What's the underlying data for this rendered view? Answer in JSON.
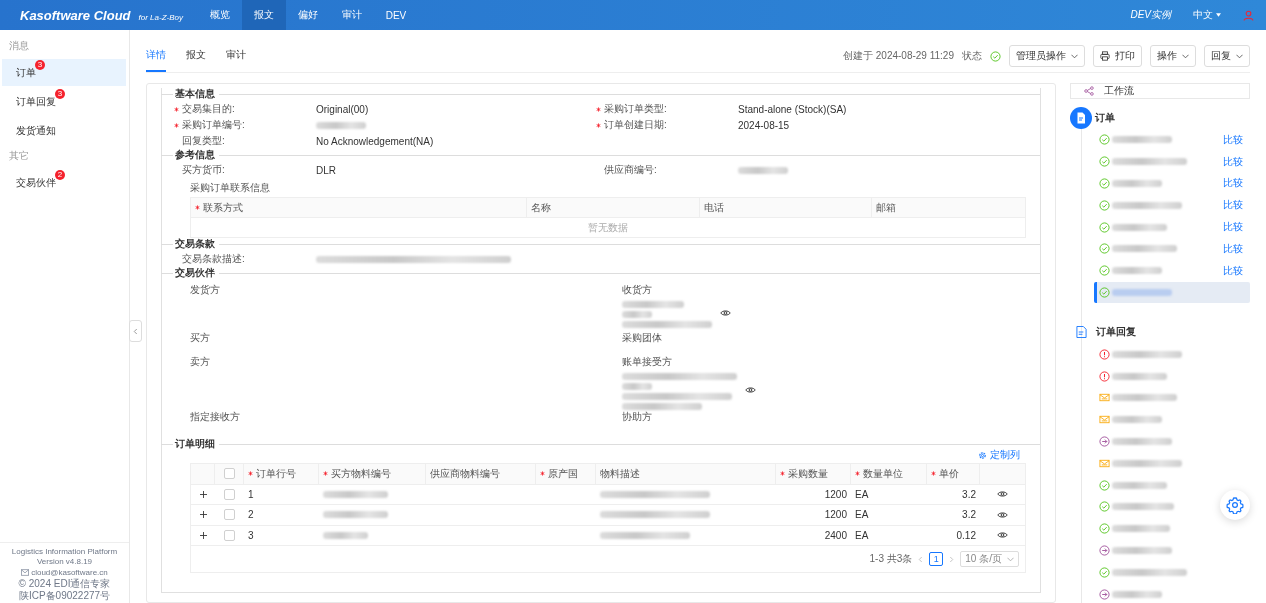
{
  "header": {
    "brand": "Kasoftware Cloud",
    "brand_sub": "for La-Z-Boy",
    "nav": [
      {
        "label": "概览",
        "selected": false
      },
      {
        "label": "报文",
        "selected": true
      },
      {
        "label": "偏好",
        "selected": false
      },
      {
        "label": "审计",
        "selected": false
      },
      {
        "label": "DEV",
        "selected": false
      }
    ],
    "instance": "DEV实例",
    "language": "中文"
  },
  "sidebar": {
    "sections": [
      {
        "title": "消息",
        "items": [
          {
            "label": "订单",
            "badge": "3",
            "selected": true
          },
          {
            "label": "订单回复",
            "badge": "3",
            "selected": false
          },
          {
            "label": "发货通知",
            "selected": false
          }
        ]
      },
      {
        "title": "其它",
        "items": [
          {
            "label": "交易伙伴",
            "badge": "2",
            "selected": false
          }
        ]
      }
    ],
    "footer": [
      "Logistics Information Platform",
      "Version v4.8.19",
      "cloud@kasoftware.cn",
      "© 2024 EDI通信专家",
      "陕ICP备09022277号"
    ]
  },
  "tabs": [
    {
      "label": "详情",
      "selected": true
    },
    {
      "label": "报文",
      "selected": false
    },
    {
      "label": "审计",
      "selected": false
    }
  ],
  "toolbar": {
    "created": "创建于 2024-08-29 11:29",
    "status_label": "状态",
    "status": {
      "kind": "ok"
    },
    "buttons": [
      {
        "label": "管理员操作",
        "kind": "dropdown"
      },
      {
        "label": "打印",
        "kind": "print"
      },
      {
        "label": "操作",
        "kind": "dropdown"
      },
      {
        "label": "回复",
        "kind": "dropdown"
      }
    ]
  },
  "basic_info": {
    "title": "基本信息",
    "fields": [
      {
        "label": "交易集目的:",
        "required": true,
        "value": "Original(00)"
      },
      {
        "label": "采购订单类型:",
        "required": true,
        "value": "Stand-alone (Stock)(SA)"
      },
      {
        "label": "采购订单编号:",
        "required": true,
        "redacted": true
      },
      {
        "label": "订单创建日期:",
        "required": true,
        "value": "2024-08-15"
      },
      {
        "label": "回复类型:",
        "required": false,
        "value": "No Acknowledgement(NA)"
      }
    ]
  },
  "reference_info": {
    "title": "参考信息",
    "fields": [
      {
        "label": "买方货币:",
        "required": false,
        "value": "DLR"
      },
      {
        "label": "供应商编号:",
        "required": false,
        "redacted": true
      }
    ],
    "contacts_title": "采购订单联系信息",
    "contacts_columns": [
      {
        "label": "联系方式",
        "required": true
      },
      {
        "label": "名称",
        "required": false
      },
      {
        "label": "电话",
        "required": false
      },
      {
        "label": "邮箱",
        "required": false
      }
    ],
    "contacts_empty": "暂无数据"
  },
  "terms": {
    "title": "交易条款",
    "fields": [
      {
        "label": "交易条款描述:",
        "required": false,
        "redacted": true
      }
    ]
  },
  "partners": {
    "title": "交易伙伴",
    "items": [
      {
        "label": "发货方",
        "redacted": false
      },
      {
        "label": "收货方",
        "redacted": true
      },
      {
        "label": "买方",
        "redacted": false
      },
      {
        "label": "采购团体",
        "redacted": false
      },
      {
        "label": "卖方",
        "redacted": false
      },
      {
        "label": "账单接受方",
        "redacted": true
      },
      {
        "label": "指定接收方",
        "redacted": false
      },
      {
        "label": "协助方",
        "redacted": false
      }
    ]
  },
  "order_lines": {
    "title": "订单明细",
    "customize": "定制列",
    "all_checked": false,
    "columns": [
      {
        "label": "订单行号",
        "required": true,
        "kind": "text"
      },
      {
        "label": "买方物料编号",
        "required": true,
        "kind": "text"
      },
      {
        "label": "供应商物料编号",
        "required": false,
        "kind": "text"
      },
      {
        "label": "原产国",
        "required": true,
        "kind": "text"
      },
      {
        "label": "物料描述",
        "required": false,
        "kind": "text"
      },
      {
        "label": "采购数量",
        "required": true,
        "kind": "number"
      },
      {
        "label": "数量单位",
        "required": true,
        "kind": "text"
      },
      {
        "label": "单价",
        "required": true,
        "kind": "number"
      }
    ],
    "rows": [
      {
        "checked": false,
        "cells": [
          {
            "text": "1"
          },
          {
            "redacted": true
          },
          {
            "redacted": false
          },
          {
            "redacted": false
          },
          {
            "redacted": true
          },
          {
            "text": "1200"
          },
          {
            "text": "EA"
          },
          {
            "text": "3.2"
          }
        ]
      },
      {
        "checked": false,
        "cells": [
          {
            "text": "2"
          },
          {
            "redacted": true
          },
          {
            "redacted": false
          },
          {
            "redacted": false
          },
          {
            "redacted": true
          },
          {
            "text": "1200"
          },
          {
            "text": "EA"
          },
          {
            "text": "3.2"
          }
        ]
      },
      {
        "checked": false,
        "cells": [
          {
            "text": "3"
          },
          {
            "redacted": true
          },
          {
            "redacted": false
          },
          {
            "redacted": false
          },
          {
            "redacted": true
          },
          {
            "text": "2400"
          },
          {
            "text": "EA"
          },
          {
            "text": "0.12"
          }
        ]
      }
    ],
    "pagination": {
      "summary": "1-3 共3条",
      "page": "1",
      "page_size": "10 条/页"
    }
  },
  "workflow": {
    "button": "工作流",
    "groups": [
      {
        "title": "订单",
        "kind": "current",
        "items": [
          {
            "kind": "ok",
            "compare": "比较",
            "selected": false
          },
          {
            "kind": "ok",
            "compare": "比较",
            "selected": false
          },
          {
            "kind": "ok",
            "compare": "比较",
            "selected": false
          },
          {
            "kind": "ok",
            "compare": "比较",
            "selected": false
          },
          {
            "kind": "ok",
            "compare": "比较",
            "selected": false
          },
          {
            "kind": "ok",
            "compare": "比较",
            "selected": false
          },
          {
            "kind": "ok",
            "compare": "比较",
            "selected": false
          },
          {
            "kind": "ok",
            "selected": true
          }
        ]
      },
      {
        "title": "订单回复",
        "kind": "related",
        "items": [
          {
            "kind": "error",
            "selected": false
          },
          {
            "kind": "error",
            "selected": false
          },
          {
            "kind": "warning",
            "selected": false
          },
          {
            "kind": "warning",
            "selected": false
          },
          {
            "kind": "pending",
            "selected": false
          },
          {
            "kind": "warning",
            "selected": false
          },
          {
            "kind": "ok",
            "selected": false
          },
          {
            "kind": "ok",
            "selected": false
          },
          {
            "kind": "ok",
            "selected": false
          },
          {
            "kind": "pending",
            "selected": false
          },
          {
            "kind": "ok",
            "selected": false
          },
          {
            "kind": "pending",
            "selected": false
          }
        ]
      }
    ]
  }
}
